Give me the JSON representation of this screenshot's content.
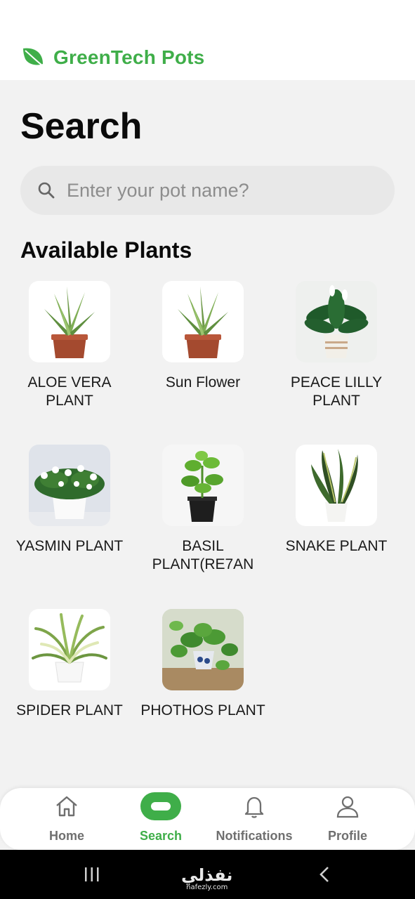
{
  "brand": {
    "name": "GreenTech Pots",
    "color": "#3fae49",
    "icon": "leaf-icon"
  },
  "page": {
    "title": "Search"
  },
  "search": {
    "placeholder": "Enter your pot name?",
    "value": "",
    "icon": "search-icon"
  },
  "section": {
    "title": "Available Plants"
  },
  "plants": [
    {
      "name": "ALOE VERA PLANT",
      "image": "aloe-vera-image"
    },
    {
      "name": "Sun Flower",
      "image": "aloe-vera-image"
    },
    {
      "name": "PEACE LILLY PLANT",
      "image": "peace-lily-image"
    },
    {
      "name": "YASMIN PLANT",
      "image": "jasmine-image"
    },
    {
      "name": "BASIL PLANT(RE7AN",
      "image": "basil-image"
    },
    {
      "name": "SNAKE PLANT",
      "image": "snake-plant-image"
    },
    {
      "name": "SPIDER PLANT",
      "image": "spider-plant-image"
    },
    {
      "name": "PHOTHOS PLANT",
      "image": "pothos-image"
    }
  ],
  "nav": {
    "items": [
      {
        "label": "Home",
        "icon": "home-icon",
        "active": false
      },
      {
        "label": "Search",
        "icon": "search-pill-icon",
        "active": true
      },
      {
        "label": "Notifications",
        "icon": "bell-icon",
        "active": false
      },
      {
        "label": "Profile",
        "icon": "user-icon",
        "active": false
      }
    ]
  },
  "watermark": {
    "main": "نفذلي",
    "sub": "nafezly.com"
  }
}
